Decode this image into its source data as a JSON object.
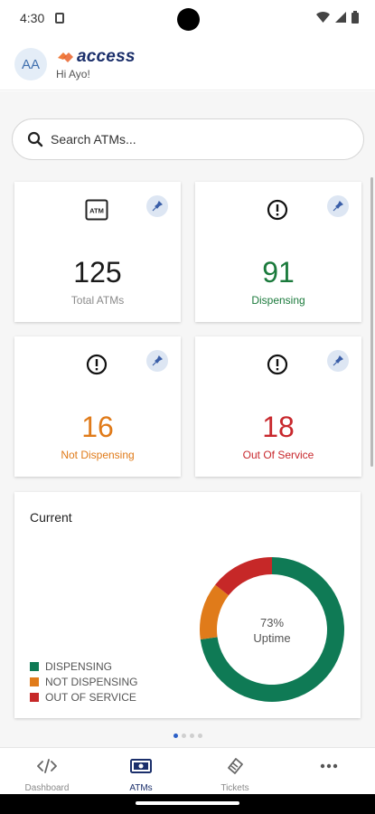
{
  "status_bar": {
    "time": "4:30"
  },
  "header": {
    "avatar_initials": "AA",
    "brand": "access",
    "greeting": "Hi Ayo!"
  },
  "search": {
    "placeholder": "Search ATMs..."
  },
  "stats": [
    {
      "value": "125",
      "label": "Total ATMs",
      "color": "#1a1a1a",
      "icon": "atm-icon"
    },
    {
      "value": "91",
      "label": "Dispensing",
      "color": "#1b7a3c",
      "icon": "alert-circle-icon"
    },
    {
      "value": "16",
      "label": "Not Dispensing",
      "color": "#e07b1a",
      "icon": "alert-circle-icon"
    },
    {
      "value": "18",
      "label": "Out Of Service",
      "color": "#c8282d",
      "icon": "alert-circle-icon"
    }
  ],
  "current_chart": {
    "title": "Current",
    "center_value": "73%",
    "center_label": "Uptime",
    "legend": [
      {
        "label": "DISPENSING",
        "color": "#0f7a55"
      },
      {
        "label": "NOT DISPENSING",
        "color": "#e07b1a"
      },
      {
        "label": "OUT OF SERVICE",
        "color": "#c62828"
      }
    ]
  },
  "chart_data": {
    "type": "pie",
    "title": "Current",
    "categories": [
      "DISPENSING",
      "NOT DISPENSING",
      "OUT OF SERVICE"
    ],
    "values": [
      91,
      16,
      18
    ],
    "colors": [
      "#0f7a55",
      "#e07b1a",
      "#c62828"
    ],
    "center_text": "73% Uptime",
    "legend_position": "bottom-left"
  },
  "pager": {
    "count": 4,
    "active": 0
  },
  "bottom_nav": [
    {
      "label": "Dashboard",
      "icon": "code-icon",
      "active": false
    },
    {
      "label": "ATMs",
      "icon": "atm-money-icon",
      "active": true
    },
    {
      "label": "Tickets",
      "icon": "ticket-icon",
      "active": false
    },
    {
      "label": "",
      "icon": "more-icon",
      "active": false
    }
  ]
}
